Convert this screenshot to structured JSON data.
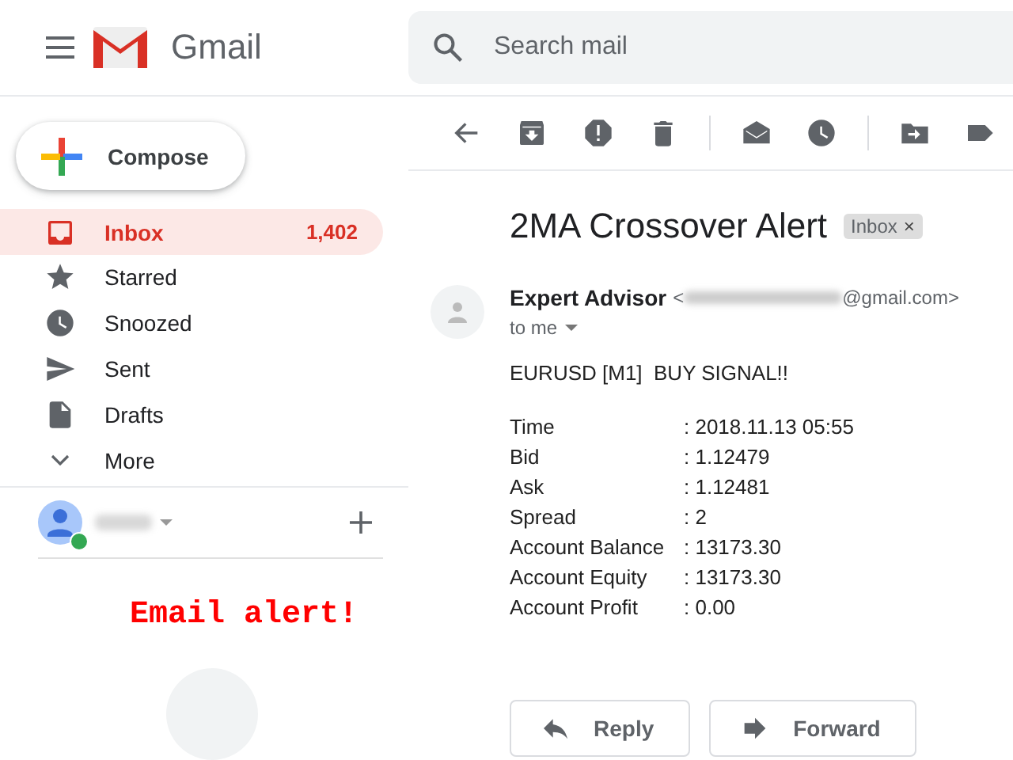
{
  "header": {
    "app_name": "Gmail",
    "search_placeholder": "Search mail"
  },
  "compose": {
    "label": "Compose"
  },
  "nav": [
    {
      "label": "Inbox",
      "count": "1,402",
      "selected": true,
      "kind": "inbox"
    },
    {
      "label": "Starred",
      "selected": false,
      "kind": "star"
    },
    {
      "label": "Snoozed",
      "selected": false,
      "kind": "clock"
    },
    {
      "label": "Sent",
      "selected": false,
      "kind": "send"
    },
    {
      "label": "Drafts",
      "selected": false,
      "kind": "file"
    },
    {
      "label": "More",
      "selected": false,
      "kind": "chevron"
    }
  ],
  "account": {
    "online": true
  },
  "annotation": "Email alert!",
  "message": {
    "subject": "2MA Crossover Alert",
    "tag": "Inbox",
    "tag_close": "×",
    "sender_name": "Expert Advisor",
    "email_open": "<",
    "email_domain": "@gmail.com>",
    "recipient": "to me",
    "headline": "EURUSD [M1]  BUY SIGNAL!!",
    "fields": [
      {
        "label": "Time",
        "value": ": 2018.11.13 05:55"
      },
      {
        "label": "Bid",
        "value": ": 1.12479"
      },
      {
        "label": "Ask",
        "value": ": 1.12481"
      },
      {
        "label": "Spread",
        "value": ": 2"
      },
      {
        "label": "Account Balance",
        "value": ": 13173.30"
      },
      {
        "label": "Account Equity",
        "value": ": 13173.30"
      },
      {
        "label": "Account Profit",
        "value": ": 0.00"
      }
    ]
  },
  "actions": [
    {
      "label": "Reply",
      "kind": "reply"
    },
    {
      "label": "Forward",
      "kind": "forward"
    }
  ]
}
